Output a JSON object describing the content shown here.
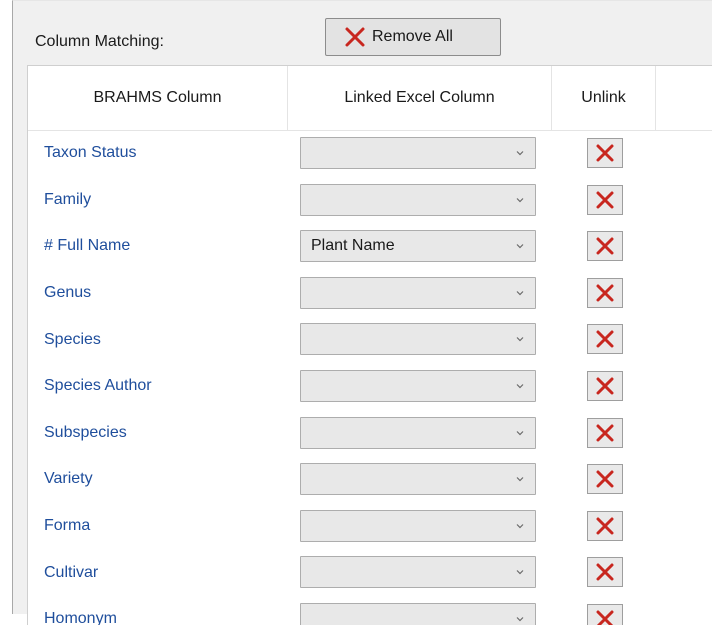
{
  "toolbar": {
    "label": "Column Matching:",
    "remove_all_label": "Remove All"
  },
  "table": {
    "headers": [
      "BRAHMS Column",
      "Linked Excel Column",
      "Unlink"
    ],
    "rows": [
      {
        "name": "Taxon Status",
        "value": ""
      },
      {
        "name": "Family",
        "value": ""
      },
      {
        "name": "# Full Name",
        "value": "Plant Name"
      },
      {
        "name": "Genus",
        "value": ""
      },
      {
        "name": "Species",
        "value": ""
      },
      {
        "name": "Species Author",
        "value": ""
      },
      {
        "name": "Subspecies",
        "value": ""
      },
      {
        "name": "Variety",
        "value": ""
      },
      {
        "name": "Forma",
        "value": ""
      },
      {
        "name": "Cultivar",
        "value": ""
      },
      {
        "name": "Homonym",
        "value": ""
      }
    ]
  },
  "colors": {
    "accent_red": "#c8271f",
    "link_blue": "#1f4e9c"
  }
}
